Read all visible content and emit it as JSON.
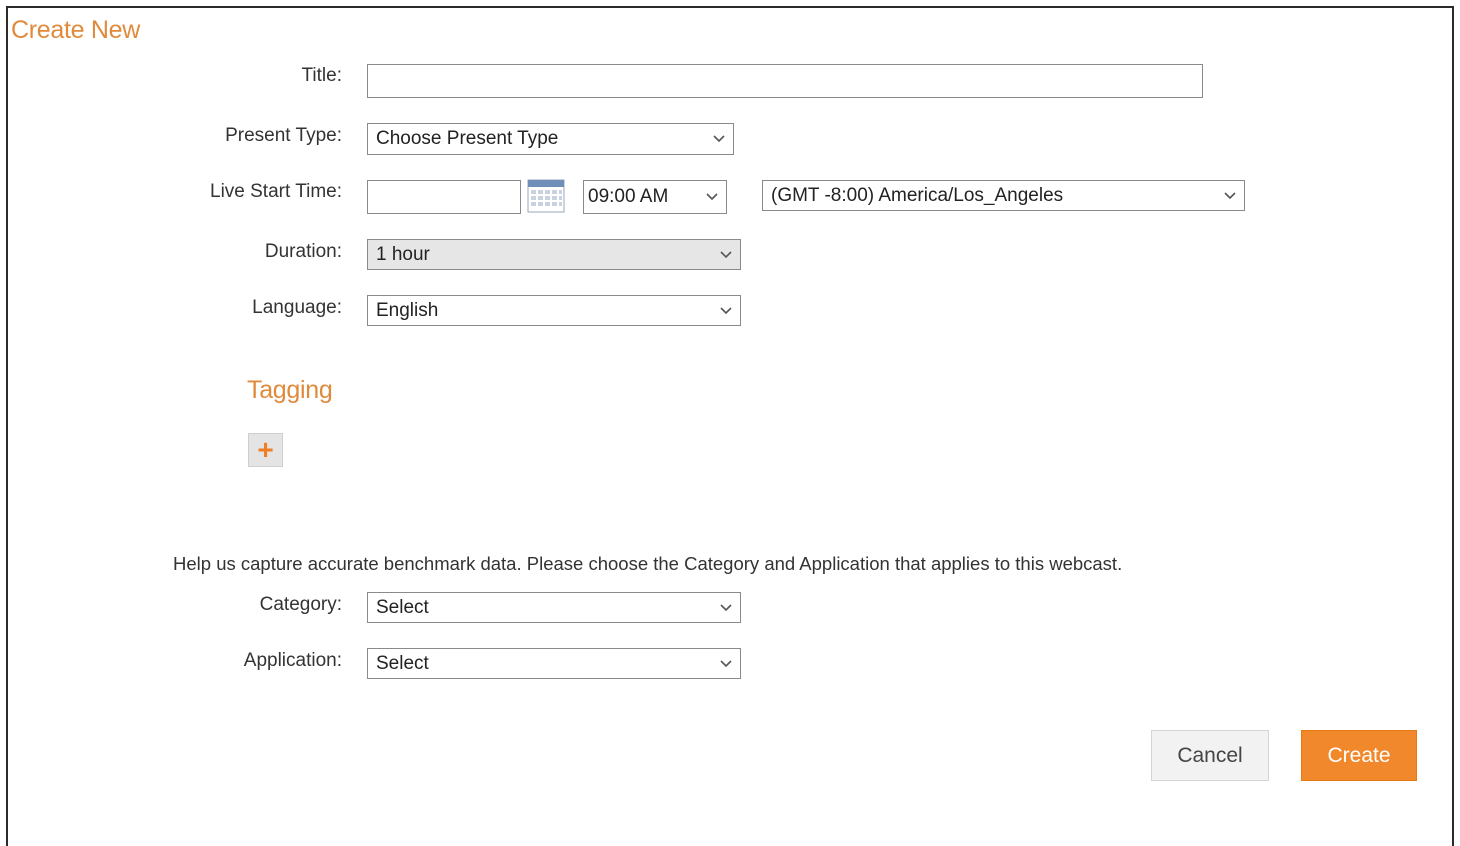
{
  "form": {
    "heading": "Create New",
    "title": {
      "label": "Title:",
      "value": ""
    },
    "present_type": {
      "label": "Present Type:",
      "selected": "Choose Present Type"
    },
    "live_start_time": {
      "label": "Live Start Time:",
      "date_value": "",
      "time_selected": "09:00 AM",
      "timezone_selected": "(GMT -8:00) America/Los_Angeles"
    },
    "duration": {
      "label": "Duration:",
      "selected": "1 hour"
    },
    "language": {
      "label": "Language:",
      "selected": "English"
    }
  },
  "tagging": {
    "heading": "Tagging",
    "add_symbol": "+"
  },
  "benchmark": {
    "help_text": "Help us capture accurate benchmark data. Please choose the Category and Application that applies to this webcast.",
    "category": {
      "label": "Category:",
      "selected": "Select"
    },
    "application": {
      "label": "Application:",
      "selected": "Select"
    }
  },
  "actions": {
    "cancel_label": "Cancel",
    "create_label": "Create"
  },
  "colors": {
    "accent": "#e08a3c",
    "create_button": "#f2882c",
    "duration_field_bg": "#e6e6e6"
  },
  "icons": {
    "calendar": "calendar-icon",
    "dropdown": "chevron-down-icon",
    "add": "plus-icon"
  }
}
